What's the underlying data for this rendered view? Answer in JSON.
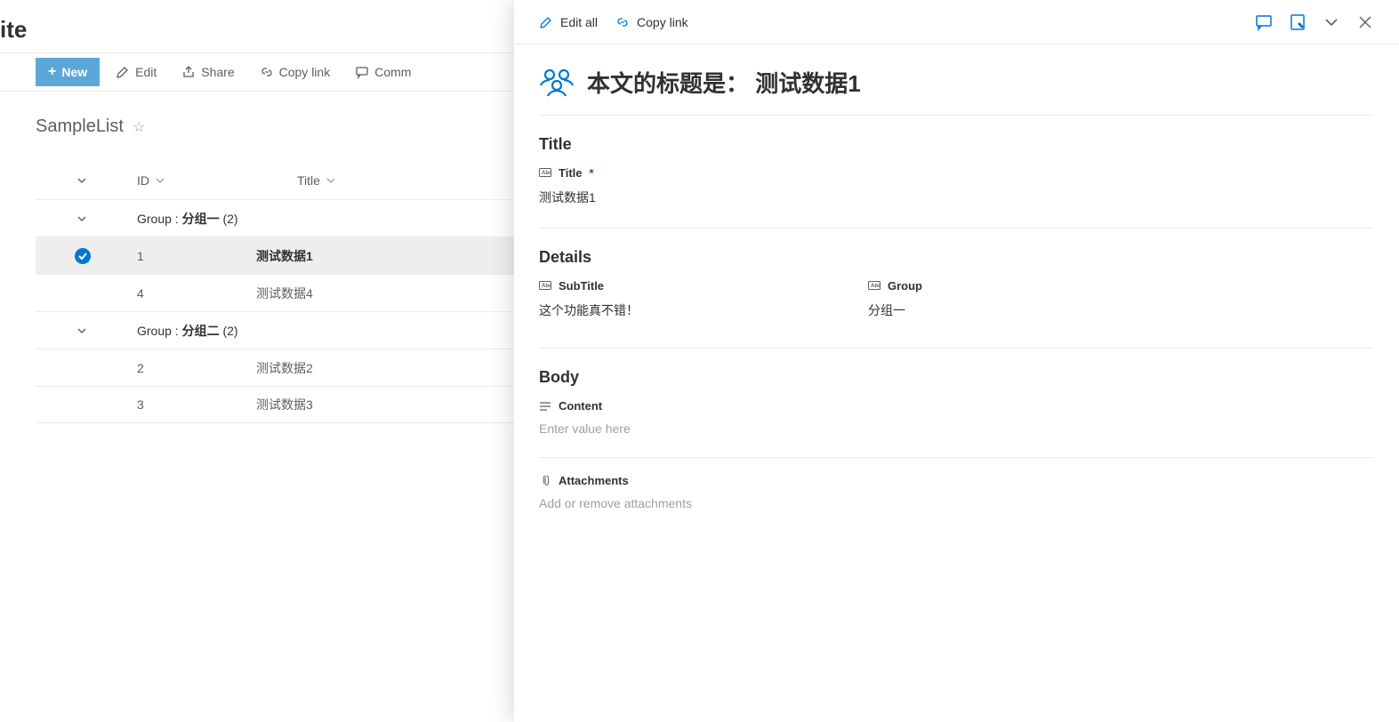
{
  "site": {
    "title_fragment": "ite"
  },
  "toolbar": {
    "new_label": "New",
    "edit_label": "Edit",
    "share_label": "Share",
    "copy_link_label": "Copy link",
    "comment_label": "Comm"
  },
  "list": {
    "name": "SampleList",
    "columns": {
      "id": "ID",
      "title": "Title"
    },
    "group_prefix": "Group : ",
    "groups": [
      {
        "label": "分组一",
        "count": "(2)",
        "items": [
          {
            "id": "1",
            "title": "测试数据1",
            "selected": true
          },
          {
            "id": "4",
            "title": "测试数据4",
            "selected": false
          }
        ]
      },
      {
        "label": "分组二",
        "count": "(2)",
        "items": [
          {
            "id": "2",
            "title": "测试数据2",
            "selected": false
          },
          {
            "id": "3",
            "title": "测试数据3",
            "selected": false
          }
        ]
      }
    ]
  },
  "panel": {
    "commands": {
      "edit_all": "Edit all",
      "copy_link": "Copy link"
    },
    "heading": "本文的标题是： 测试数据1",
    "sections": {
      "title_section": "Title",
      "details_section": "Details",
      "body_section": "Body"
    },
    "fields": {
      "title": {
        "label": "Title",
        "value": "测试数据1",
        "required": true
      },
      "subtitle": {
        "label": "SubTitle",
        "value": "这个功能真不错！"
      },
      "group": {
        "label": "Group",
        "value": "分组一"
      },
      "content": {
        "label": "Content",
        "placeholder": "Enter value here"
      },
      "attachments": {
        "label": "Attachments",
        "placeholder": "Add or remove attachments"
      }
    }
  }
}
